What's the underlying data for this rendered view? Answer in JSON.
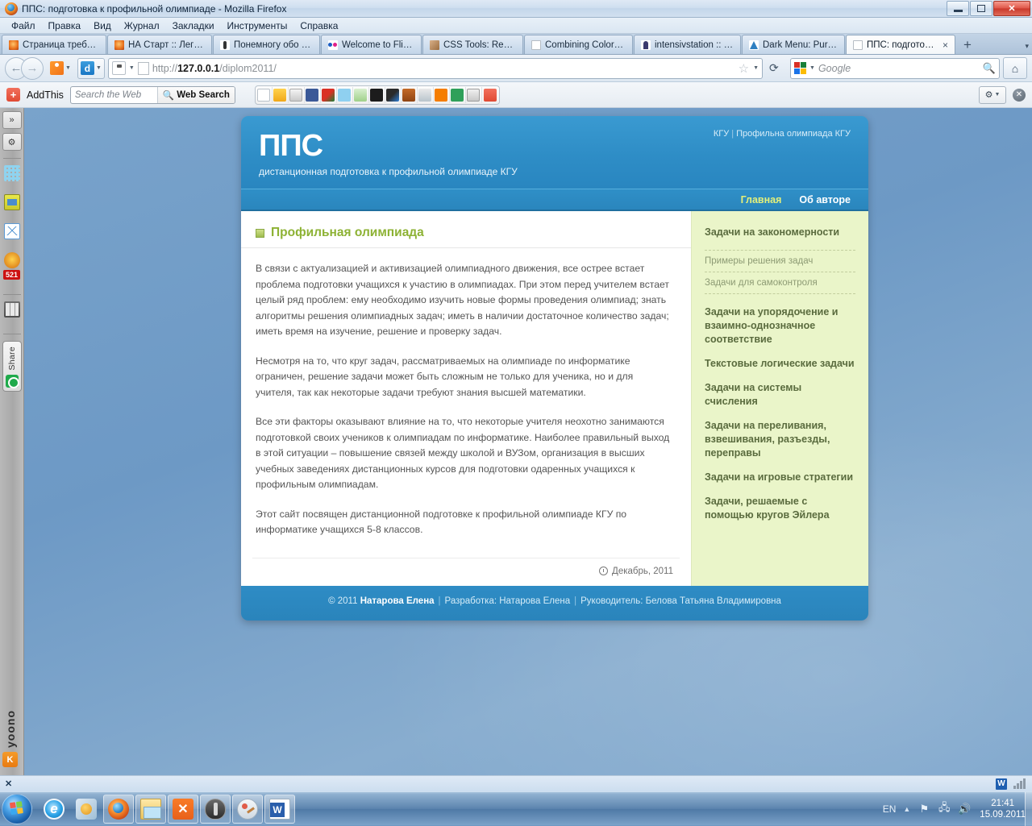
{
  "window": {
    "title": "ППС: подготовка к профильной олимпиаде - Mozilla Firefox",
    "minimize_label": "Свернуть",
    "restore_label": "Восстановить",
    "close_label": "Закрыть"
  },
  "menubar": [
    {
      "label": "Файл"
    },
    {
      "label": "Правка"
    },
    {
      "label": "Вид"
    },
    {
      "label": "Журнал"
    },
    {
      "label": "Закладки"
    },
    {
      "label": "Инструменты"
    },
    {
      "label": "Справка"
    }
  ],
  "tabs": [
    {
      "label": "Страница требует...",
      "favicon": "firefox-icon",
      "active": false
    },
    {
      "label": "НА Старт :: Легкая...",
      "favicon": "firefox-icon",
      "active": false
    },
    {
      "label": "Понемногу обо вс...",
      "favicon": "stickman-icon",
      "active": false
    },
    {
      "label": "Welcome to Flickr!",
      "favicon": "flickr-dots-icon",
      "active": false
    },
    {
      "label": "CSS Tools: Reset C...",
      "favicon": "portrait-icon",
      "active": false
    },
    {
      "label": "Combining Colors ...",
      "favicon": "page-icon",
      "active": false
    },
    {
      "label": "intensivstation :: C...",
      "favicon": "person-icon",
      "active": false
    },
    {
      "label": "Dark Menu: Pure C...",
      "favicon": "triangle-icon",
      "active": false
    },
    {
      "label": "ППС: подготов...",
      "favicon": "page-icon",
      "active": true,
      "close_label": "×"
    }
  ],
  "tab_controls": {
    "new_tab": "+",
    "tab_list": "▾"
  },
  "navbar": {
    "back_label": "◀",
    "forward_label": "▶",
    "url_scheme": "http://",
    "url_host": "127.0.0.1",
    "url_path": "/diplom2011/",
    "url_full": "http://127.0.0.1/diplom2011/",
    "bookmark_star": "☆",
    "reload_label": "⟳",
    "search_engine": "Google",
    "search_placeholder": "Google",
    "home_label": "⌂"
  },
  "addthis_bar": {
    "brand": "AddThis",
    "logo_glyph": "+",
    "search_placeholder": "Search the Web",
    "search_button": "Web Search",
    "search_button_icon": "magnifier-icon",
    "share_icons": [
      "email-icon",
      "favorites-star-icon",
      "print-icon",
      "facebook-icon",
      "google-icon",
      "twitter-icon",
      "myspace-icon",
      "mymail-icon",
      "delicious-icon",
      "stumble-beaver-icon",
      "diigo-icon",
      "blogger-icon",
      "stumbleupon-icon",
      "bookmark-icon",
      "addthis-plus-icon"
    ],
    "wrench_label": "⚙",
    "close_label": "✕"
  },
  "yoono_sidebar": {
    "expand_label": "»",
    "settings_label": "⚙",
    "icons": [
      "grid-icon",
      "photo-icon",
      "mail-icon",
      "star-icon"
    ],
    "badge_count": "521",
    "panel_icon": "panel-icon",
    "share_label": "Share",
    "brand": "yoono"
  },
  "site": {
    "breadcrumb_left": "КГУ",
    "breadcrumb_sep": "|",
    "breadcrumb_right": "Профильна олимпиада КГУ",
    "logo": "ППС",
    "tagline": "дистанционная подготовка к профильной олимпиаде КГУ",
    "nav": [
      {
        "label": "Главная",
        "active": true
      },
      {
        "label": "Об авторе",
        "active": false
      }
    ],
    "page_title": "Профильная олимпиада",
    "paragraphs": [
      "В связи с актуализацией и активизацией олимпиадного движения, все острее встает проблема подготовки учащихся к участию в олимпиадах. При этом перед учителем встает целый ряд проблем: ему необходимо изучить новые формы проведения олимпиад; знать алгоритмы решения олимпиадных задач; иметь в наличии достаточное количество задач; иметь время на изучение, решение и проверку задач.",
      "Несмотря на то, что круг задач, рассматриваемых на олимпиаде по информатике ограничен, решение задачи может быть сложным не только для ученика, но и для учителя, так как некоторые задачи требуют знания высшей математики.",
      "Все эти факторы оказывают влияние на то, что некоторые учителя неохотно занимаются подготовкой своих учеников к олимпиадам по информатике. Наиболее правильный выход в этой ситуации – повышение связей между школой и ВУЗом, организация в высших учебных заведениях дистанционных курсов для подготовки одаренных учащихся к профильным олимпиадам.",
      "Этот сайт посвящен дистанционной подготовке к профильной олимпиаде КГУ по информатике учащихся 5-8 классов."
    ],
    "date_label": "Декабрь, 2011",
    "date_icon": "clock-icon",
    "sidebar": {
      "main_first": "Задачи на закономерности",
      "sub_items": [
        "Примеры решения задач",
        "Задачи для самоконтроля"
      ],
      "items": [
        "Задачи на упорядочение и взаимно-однозначное соответствие",
        "Текстовые логические задачи",
        "Задачи на системы счисления",
        "Задачи на переливания, взвешивания, разъезды, переправы",
        "Задачи на игровые стратегии",
        "Задачи, решаемые с помощью кругов Эйлера"
      ]
    },
    "footer": {
      "copyright": "© 2011",
      "author": "Натарова Елена",
      "dev_label": "Разработка: Натарова Елена",
      "supervisor_label": "Руководитель: Белова Татьяна Владимировна",
      "sep": "|"
    },
    "colors": {
      "header_blue": "#2e8dc6",
      "nav_active": "#e4f07a",
      "title_green": "#8db234",
      "sidebar_bg": "#eaf5c9",
      "body_text": "#555555"
    }
  },
  "taskbar": {
    "close_row_glyph": "✕",
    "tray_row_icons": [
      "word-icon",
      "signal-bars-icon"
    ],
    "start_label": "Пуск",
    "items": [
      {
        "name": "internet-explorer",
        "pinned": false
      },
      {
        "name": "windows-media-player",
        "pinned": false
      },
      {
        "name": "firefox",
        "pinned": true
      },
      {
        "name": "explorer-folder",
        "pinned": true
      },
      {
        "name": "xampp",
        "pinned": true
      },
      {
        "name": "world-of-tanks",
        "pinned": true
      },
      {
        "name": "paint",
        "pinned": true
      },
      {
        "name": "word",
        "pinned": true
      }
    ],
    "language": "EN",
    "tray_icons": [
      "caret-up-icon",
      "flag-icon",
      "network-icon",
      "volume-icon"
    ],
    "time": "21:41",
    "date": "15.09.2011"
  }
}
